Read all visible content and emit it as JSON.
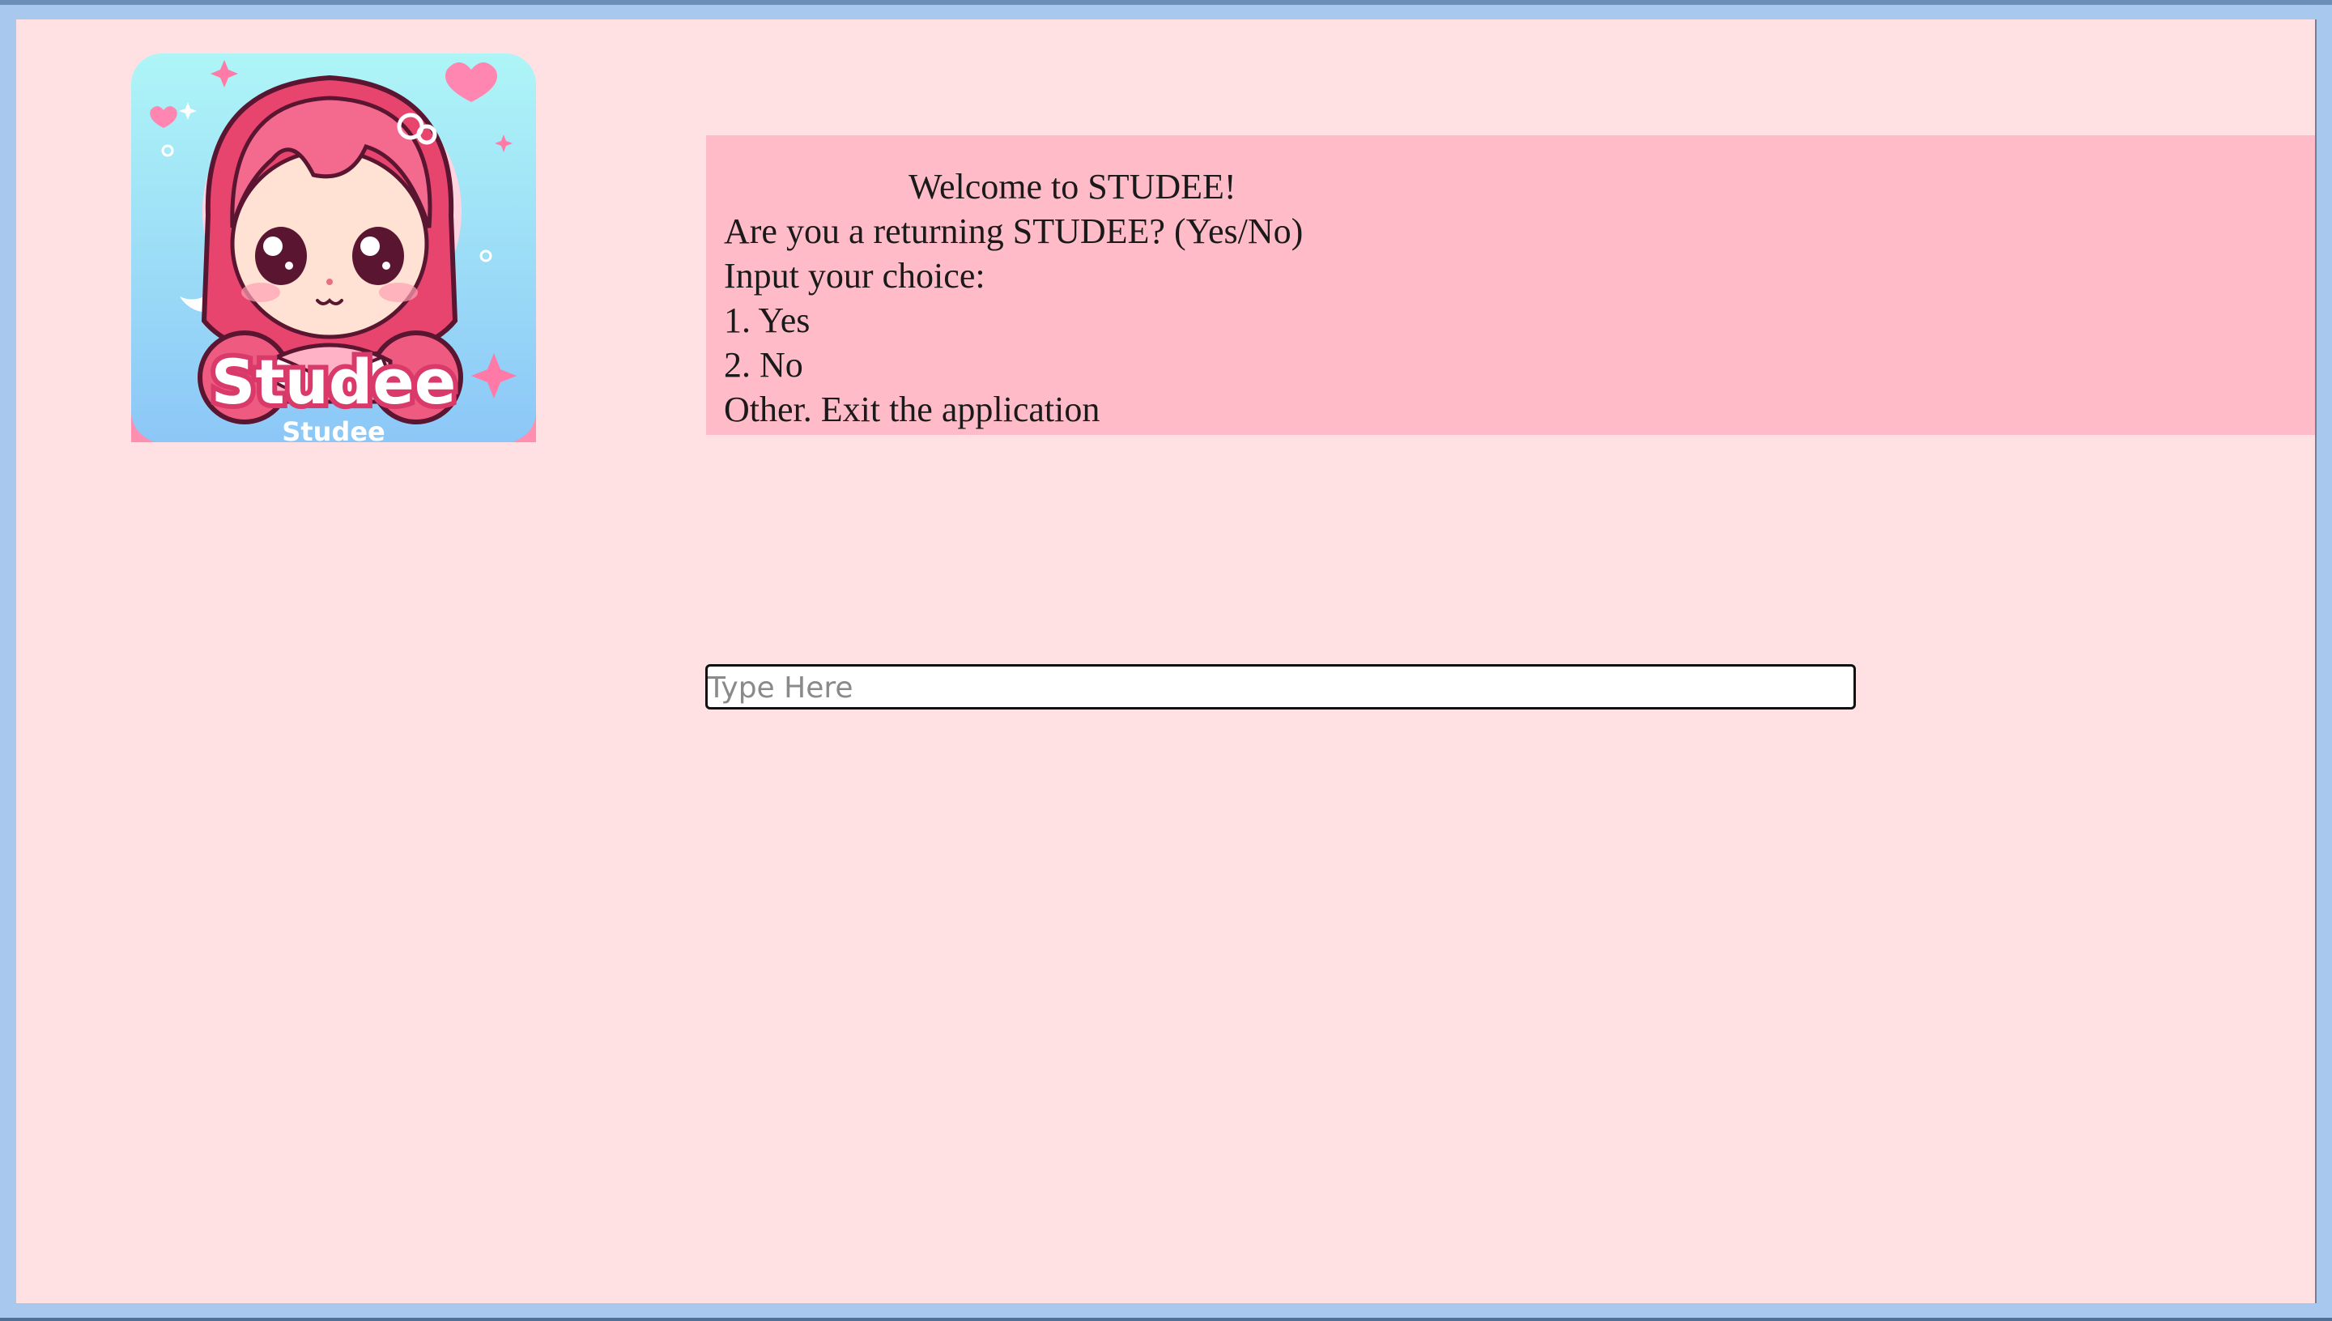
{
  "logo": {
    "wordmark": "Studee",
    "caption": "Studee"
  },
  "message": {
    "welcome": "Welcome to STUDEE!",
    "question": "Are you a returning STUDEE? (Yes/No)",
    "prompt": "Input your choice:",
    "options": [
      "1. Yes",
      "2. No",
      "Other. Exit the application"
    ]
  },
  "input": {
    "placeholder": "Type Here",
    "value": ""
  },
  "colors": {
    "background": "#ffe1e4",
    "panel": "#ffbbc8",
    "frame": "#a8c8ee"
  },
  "icons": {
    "logo": "chibi-girl-mascot-icon"
  }
}
